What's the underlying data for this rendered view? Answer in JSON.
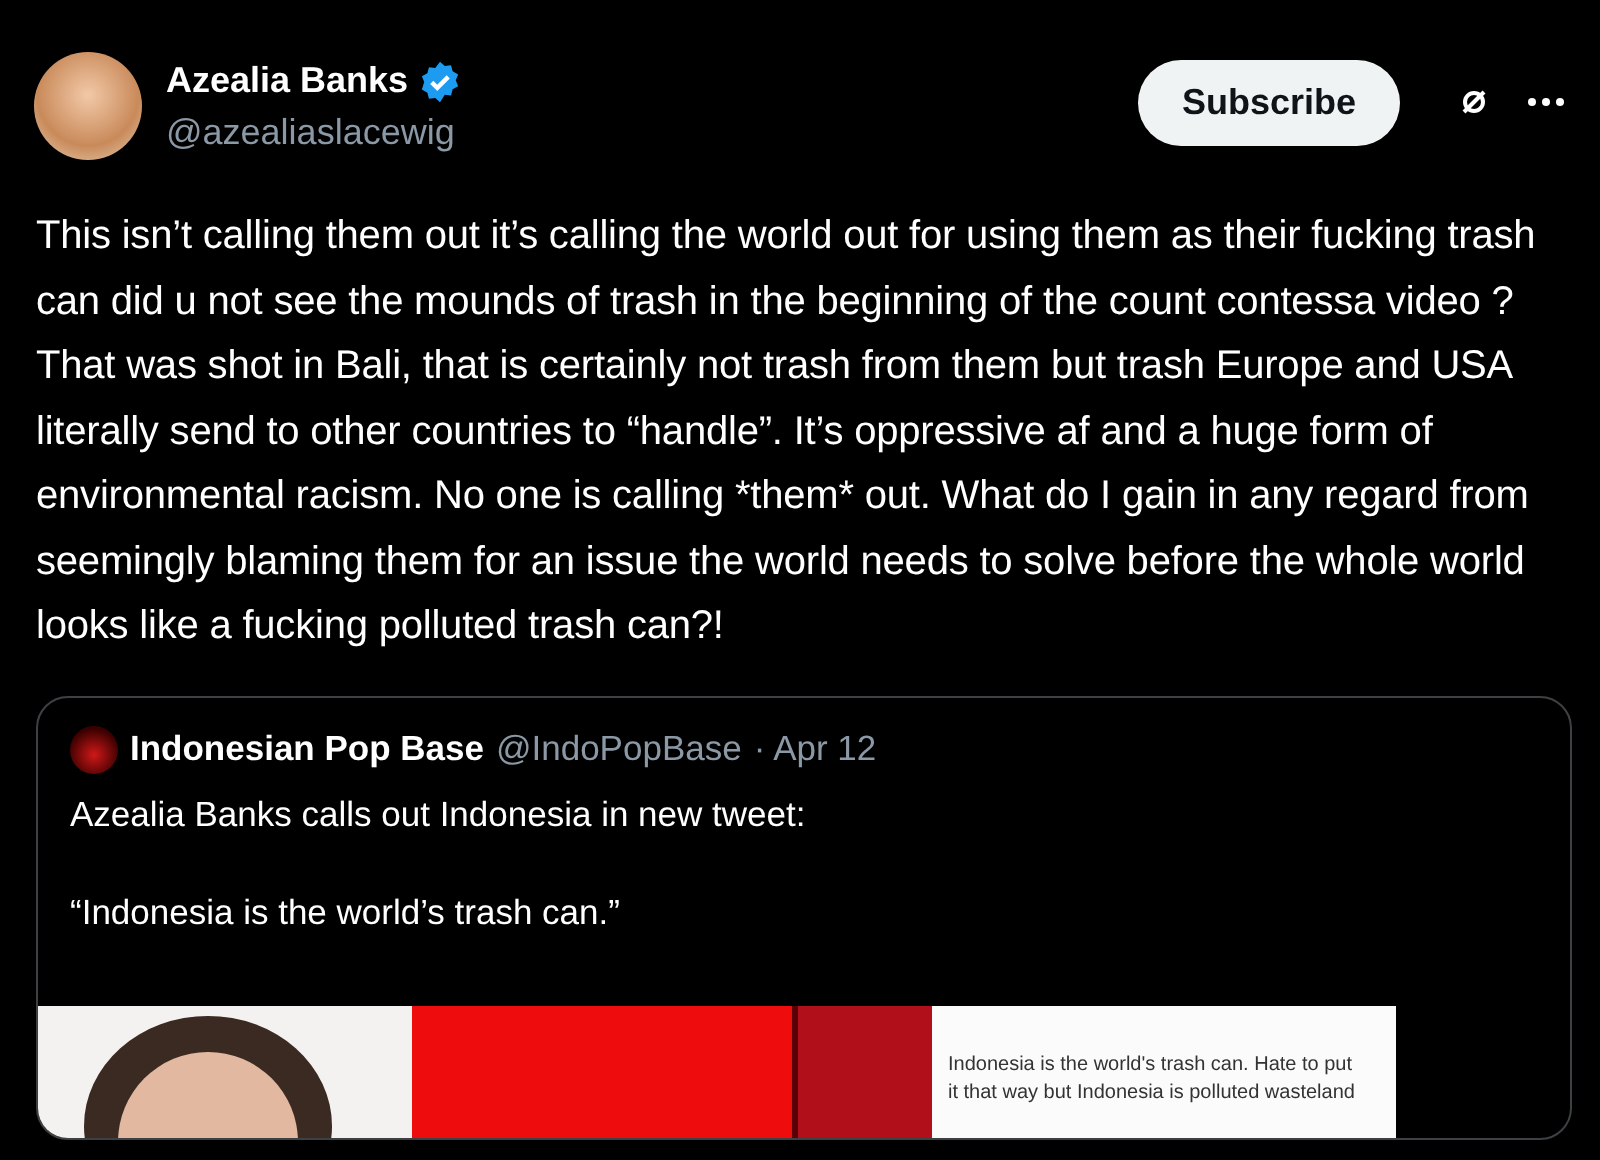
{
  "author": {
    "name": "Azealia Banks",
    "verified": true,
    "handle": "@azealiaslacewig"
  },
  "subscribe_button": "Subscribe",
  "body": "This isn’t calling them out it’s calling the world out for using them as their fucking trash can did u not see the mounds of trash in the beginning of the count contessa video ? That was shot in Bali, that is certainly not trash from them but trash Europe and USA literally send to other countries to “handle”. It’s oppressive af and a huge form of environmental racism. No one is calling *them* out. What do I gain in any regard from seemingly blaming them for an issue the world needs to solve before the whole world looks like a fucking polluted trash can?!",
  "quoted": {
    "name": "Indonesian Pop Base",
    "handle": "@IndoPopBase",
    "date": "· Apr 12",
    "lines": [
      "Azealia Banks calls out Indonesia in new tweet:",
      "“Indonesia is the world’s trash can.”"
    ],
    "media": {
      "kind": "picture",
      "screenshot_lines": [
        "Indonesia is the world's trash can. Hate to put",
        "it that way but Indonesia is polluted wasteland"
      ]
    }
  }
}
